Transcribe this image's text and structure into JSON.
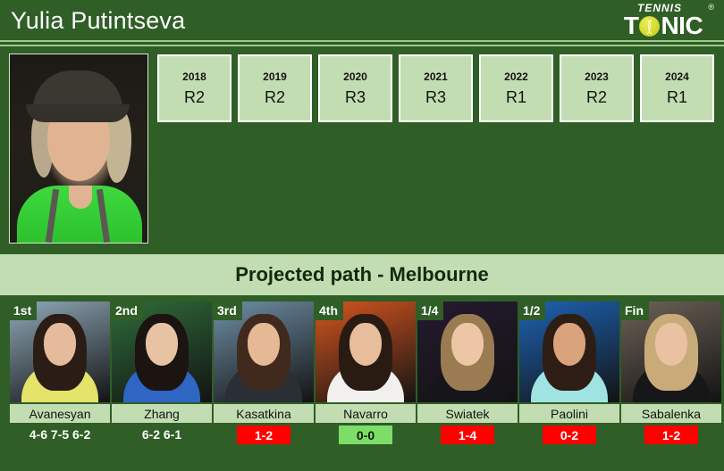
{
  "header": {
    "player_name": "Yulia Putintseva",
    "logo_top": "TENNIS",
    "logo_left": "T",
    "logo_right": "NIC",
    "logo_registered": "®"
  },
  "history": {
    "cells": [
      {
        "year": "2018",
        "result": "R2"
      },
      {
        "year": "2019",
        "result": "R2"
      },
      {
        "year": "2020",
        "result": "R3"
      },
      {
        "year": "2021",
        "result": "R3"
      },
      {
        "year": "2022",
        "result": "R1"
      },
      {
        "year": "2023",
        "result": "R2"
      },
      {
        "year": "2024",
        "result": "R1"
      }
    ]
  },
  "banner": {
    "title": "Projected path - Melbourne"
  },
  "path": {
    "cards": [
      {
        "round": "1st",
        "opponent": "Avanesyan",
        "score": "4-6 7-5 6-2",
        "score_type": "plain",
        "photo": {
          "bg": "#8fa8b8",
          "hair": "#2b1c16",
          "skin": "#e6bb9c",
          "outfit": "#e4e36a"
        }
      },
      {
        "round": "2nd",
        "opponent": "Zhang",
        "score": "6-2 6-1",
        "score_type": "plain",
        "photo": {
          "bg": "#2f6b3a",
          "hair": "#1b1410",
          "skin": "#e8c3a3",
          "outfit": "#2f66c4"
        }
      },
      {
        "round": "3rd",
        "opponent": "Kasatkina",
        "score": "1-2",
        "score_type": "red",
        "photo": {
          "bg": "#6f8fa6",
          "hair": "#402a1d",
          "skin": "#e6b894",
          "outfit": "#2a2f35"
        }
      },
      {
        "round": "4th",
        "opponent": "Navarro",
        "score": "0-0",
        "score_type": "green",
        "photo": {
          "bg": "#d4551f",
          "hair": "#2a1b12",
          "skin": "#e7bd9b",
          "outfit": "#f2f0ee"
        }
      },
      {
        "round": "1/4",
        "opponent": "Swiatek",
        "score": "1-4",
        "score_type": "red",
        "photo": {
          "bg": "#241a2e",
          "hair": "#9a7b52",
          "skin": "#edc6a6",
          "outfit": "#15151a"
        }
      },
      {
        "round": "1/2",
        "opponent": "Paolini",
        "score": "0-2",
        "score_type": "red",
        "photo": {
          "bg": "#1d63b4",
          "hair": "#2e1d14",
          "skin": "#d9a47c",
          "outfit": "#9fe4e2"
        }
      },
      {
        "round": "Fin",
        "opponent": "Sabalenka",
        "score": "1-2",
        "score_type": "red",
        "photo": {
          "bg": "#6d6257",
          "hair": "#c9ab79",
          "skin": "#e9c2a3",
          "outfit": "#17171a"
        }
      }
    ]
  },
  "colors": {
    "background_green": "#2f5e26",
    "panel_light_green": "#c3ddb2",
    "badge_red": "#ff0000",
    "badge_green": "#7edd69",
    "title_white": "#ffffff"
  }
}
